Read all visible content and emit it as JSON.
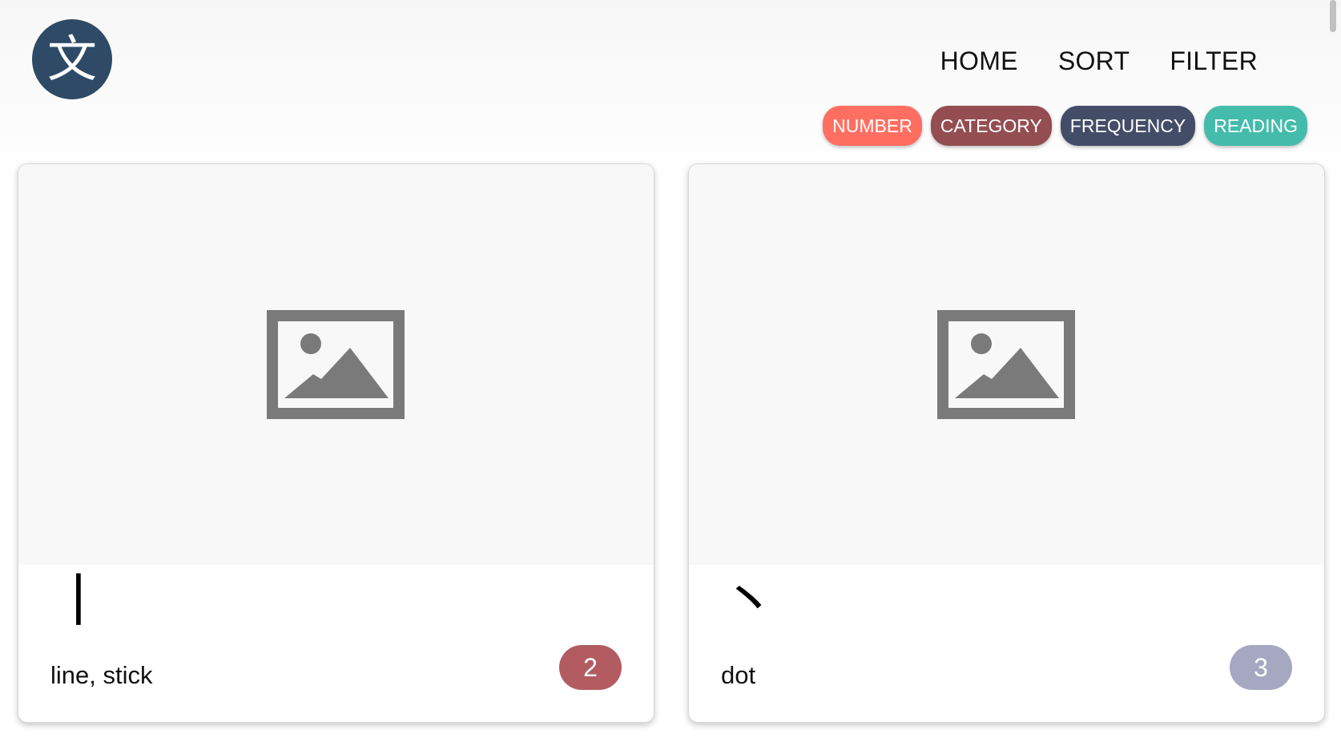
{
  "header": {
    "logo_char": "文",
    "nav": [
      {
        "label": "HOME"
      },
      {
        "label": "SORT"
      },
      {
        "label": "FILTER"
      }
    ],
    "sort_pills": [
      {
        "label": "NUMBER",
        "color": "#ff6f61"
      },
      {
        "label": "CATEGORY",
        "color": "#944e51"
      },
      {
        "label": "FREQUENCY",
        "color": "#434d68"
      },
      {
        "label": "READING",
        "color": "#44bcac"
      }
    ]
  },
  "cards": [
    {
      "char": "丨",
      "label": "line, stick",
      "count": "2",
      "badge_color": "#b25c62"
    },
    {
      "char": "丶",
      "label": "dot",
      "count": "3",
      "badge_color": "#a6a8c2"
    }
  ],
  "colors": {
    "logo_bg": "#2e4a66",
    "image_placeholder": "#7a7a7a"
  }
}
